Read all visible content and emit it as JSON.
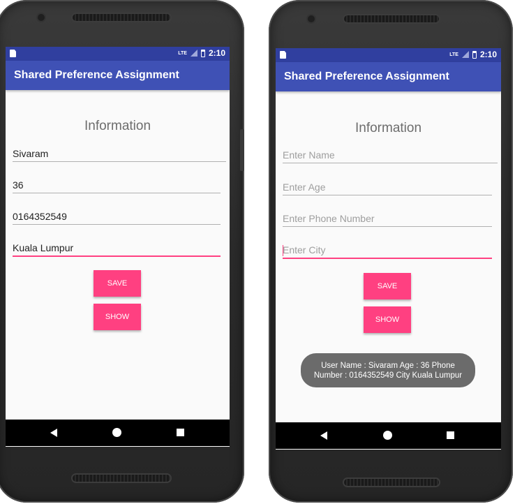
{
  "status_bar": {
    "network": "LTE",
    "time": "2:10"
  },
  "app_title": "Shared Preference Assignment",
  "left_screen": {
    "heading": "Information",
    "fields": {
      "name": "Sivaram",
      "age": "36",
      "phone": "0164352549",
      "city": "Kuala Lumpur"
    }
  },
  "right_screen": {
    "heading": "Information",
    "placeholders": {
      "name": "Enter Name",
      "age": "Enter Age",
      "phone": "Enter Phone Number",
      "city": "Enter City"
    },
    "toast": "User Name : Sivaram Age : 36 Phone Number : 0164352549 City Kuala Lumpur"
  },
  "buttons": {
    "save": "SAVE",
    "show": "SHOW"
  },
  "colors": {
    "primary": "#3f51b5",
    "primary_dark": "#303f9f",
    "accent": "#ff4081",
    "toast": "#6b6b6b"
  },
  "icons": [
    "sim-card-icon",
    "signal-icon",
    "battery-icon",
    "back-icon",
    "home-icon",
    "recent-apps-icon"
  ]
}
